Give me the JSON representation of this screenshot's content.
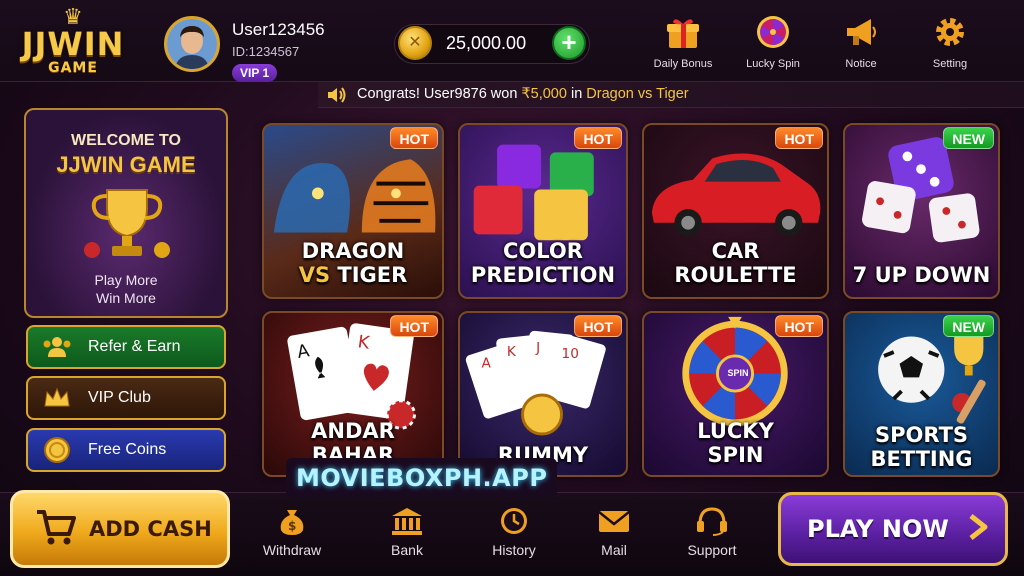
{
  "brand": {
    "logo_main": "JJWIN",
    "logo_sub": "GAME"
  },
  "user": {
    "name": "User123456",
    "id_text": "ID:1234567",
    "vip_label": "VIP 1"
  },
  "wallet": {
    "balance": "25,000.00",
    "add_symbol": "+"
  },
  "top_actions": [
    {
      "label": "Daily Bonus",
      "icon": "gift-icon"
    },
    {
      "label": "Lucky Spin",
      "icon": "wheel-icon"
    },
    {
      "label": "Notice",
      "icon": "megaphone-icon"
    },
    {
      "label": "Setting",
      "icon": "gear-icon"
    }
  ],
  "marquee": {
    "prefix": "Congrats! User9876 won ",
    "amount": "₹5,000",
    "middle": " in ",
    "game": "Dragon vs Tiger"
  },
  "welcome": {
    "line1": "WELCOME TO",
    "line2": "JJWIN GAME",
    "sub1": "Play More",
    "sub2": "Win More"
  },
  "side_buttons": [
    {
      "label": "Refer & Earn",
      "icon": "people-icon"
    },
    {
      "label": "VIP Club",
      "icon": "crown-icon"
    },
    {
      "label": "Free Coins",
      "icon": "coin-icon"
    }
  ],
  "games": [
    {
      "line1": "DRAGON",
      "line2a": "VS",
      "line2b": " TIGER",
      "tag": "HOT"
    },
    {
      "line1": "COLOR",
      "line2": "PREDICTION",
      "tag": "HOT"
    },
    {
      "line1": "CAR",
      "line2": "ROULETTE",
      "tag": "HOT"
    },
    {
      "line1": "7 UP DOWN",
      "tag": "NEW"
    },
    {
      "line1": "ANDAR",
      "line2": "BAHAR",
      "tag": "HOT"
    },
    {
      "line1": "RUMMY",
      "tag": "HOT"
    },
    {
      "line1": "LUCKY",
      "line2": "SPIN",
      "tag": "HOT",
      "wheel_center": "SPIN"
    },
    {
      "line1": "SPORTS",
      "line2": "BETTING",
      "tag": "NEW"
    }
  ],
  "bottom_nav": {
    "add_cash": "ADD CASH",
    "items": [
      {
        "label": "Withdraw",
        "icon": "money-bag-icon"
      },
      {
        "label": "Bank",
        "icon": "bank-icon"
      },
      {
        "label": "History",
        "icon": "clock-icon"
      },
      {
        "label": "Mail",
        "icon": "mail-icon"
      },
      {
        "label": "Support",
        "icon": "headset-icon"
      }
    ],
    "play_now": "PLAY NOW"
  },
  "watermark": "MOVIEBOXPH.APP",
  "colors": {
    "gold": "#f5c542",
    "purple": "#6a28b8",
    "green": "#1e9a2c",
    "hot": "#e85a18"
  }
}
